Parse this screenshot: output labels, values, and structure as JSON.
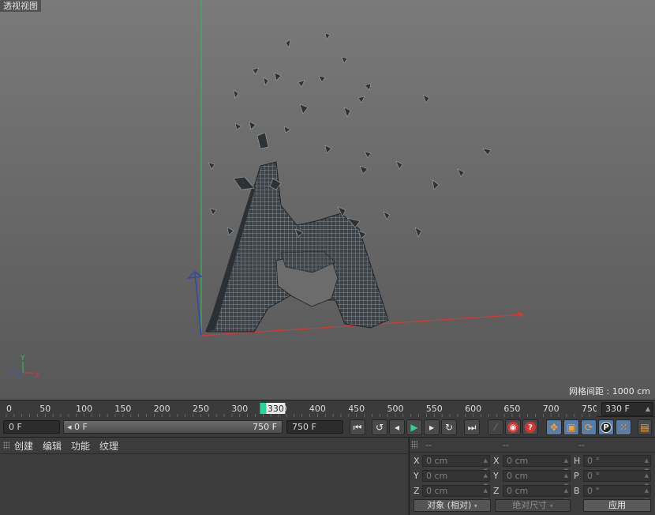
{
  "viewport": {
    "title": "透视视图",
    "grid_spacing": "网格间距 : 1000 cm",
    "axis_labels": {
      "x": "X",
      "y": "Y",
      "z": "Z"
    }
  },
  "timeline": {
    "ticks": [
      "0",
      "50",
      "100",
      "150",
      "200",
      "250",
      "300",
      "350",
      "400",
      "450",
      "500",
      "550",
      "600",
      "650",
      "700",
      "750"
    ],
    "current_frame_label": "330",
    "current_frame_value": 330,
    "frame_field": "330 F",
    "start_field": "0 F",
    "range_start": "0 F",
    "range_end": "750 F",
    "end_field": "750 F",
    "accent_color": "#29d39a"
  },
  "transport": {
    "buttons": [
      "go-to-start",
      "prev-key",
      "prev-frame",
      "play",
      "next-frame",
      "next-key",
      "go-to-end"
    ],
    "record_buttons": [
      "record-key",
      "autokey",
      "keyframe-selection"
    ],
    "key_buttons": [
      "position-key",
      "scale-key",
      "rotation-key",
      "param-key",
      "point-level",
      "scheme"
    ]
  },
  "object_manager": {
    "menu": [
      "创建",
      "编辑",
      "功能",
      "纹理"
    ]
  },
  "coordinates": {
    "headers": [
      "--",
      "--",
      "--"
    ],
    "rows": [
      {
        "a_label": "X",
        "a_value": "0 cm",
        "b_label": "X",
        "b_value": "0 cm",
        "c_label": "H",
        "c_value": "0 °"
      },
      {
        "a_label": "Y",
        "a_value": "0 cm",
        "b_label": "Y",
        "b_value": "0 cm",
        "c_label": "P",
        "c_value": "0 °"
      },
      {
        "a_label": "Z",
        "a_value": "0 cm",
        "b_label": "Z",
        "b_value": "0 cm",
        "c_label": "B",
        "c_value": "0 °"
      }
    ],
    "mode_dropdown": "对象 (相对)",
    "size_dropdown": "绝对尺寸",
    "apply_button": "应用"
  }
}
